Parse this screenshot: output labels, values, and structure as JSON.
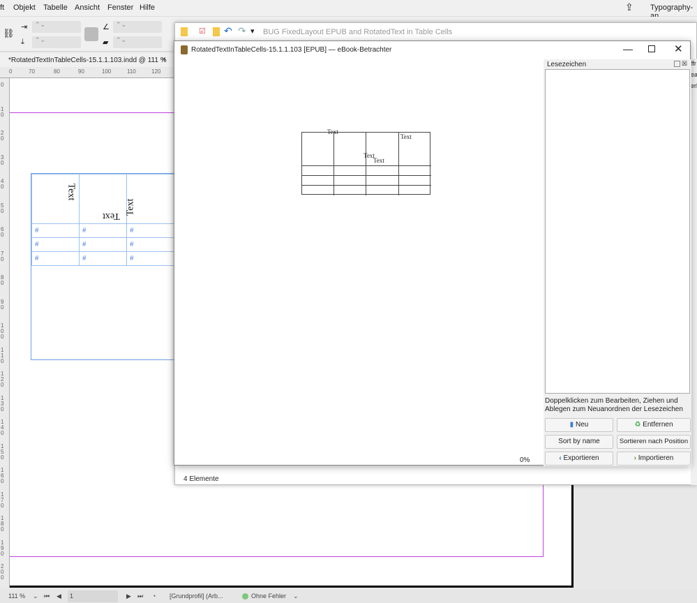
{
  "menubar": {
    "items": [
      "ft",
      "Objekt",
      "Tabelle",
      "Ansicht",
      "Fenster",
      "Hilfe"
    ],
    "workspace": "Typography-an"
  },
  "document": {
    "tab_title": "*RotatedTextInTableCells-15.1.1.103.indd @ 111 %",
    "ruler_ticks": [
      "0",
      "70",
      "80",
      "90",
      "100",
      "110",
      "120"
    ],
    "vruler_ticks": [
      "0",
      "10",
      "20",
      "30",
      "40",
      "50",
      "60",
      "70",
      "80",
      "90",
      "100",
      "110",
      "120",
      "130",
      "140",
      "150",
      "160",
      "170",
      "180",
      "190",
      "200"
    ],
    "table": {
      "header": [
        "Text",
        "Text",
        "Text"
      ],
      "marker": "#"
    }
  },
  "status": {
    "zoom": "111 %",
    "page": "1",
    "profile": "[Grundprofil] (Arb...",
    "preflight": "Ohne Fehler",
    "preflight_color": "#7dc77d"
  },
  "back_window": {
    "title": "BUG FixedLayout EPUB and RotatedText in Table Cells",
    "footer": "4 Elemente"
  },
  "viewer": {
    "title": "RotatedTextInTableCells-15.1.1.103 [EPUB] — eBook-Betrachter",
    "progress": "0%",
    "epub_table": {
      "texts": [
        "Text",
        "Text",
        "Text",
        "Text"
      ]
    },
    "bookmarks": {
      "title": "Lesezeichen",
      "hint": "Doppelklicken zum Bearbeiten, Ziehen und Ablegen zum Neuanordnen der Lesezeichen",
      "buttons": {
        "new": "Neu",
        "remove": "Entfernen",
        "sort_name": "Sort by name",
        "sort_pos": "Sortieren nach Position",
        "export": "Exportieren",
        "import": "Importieren"
      }
    }
  },
  "right_panel": {
    "fragments": [
      "ffr",
      "ear",
      "erl"
    ]
  }
}
